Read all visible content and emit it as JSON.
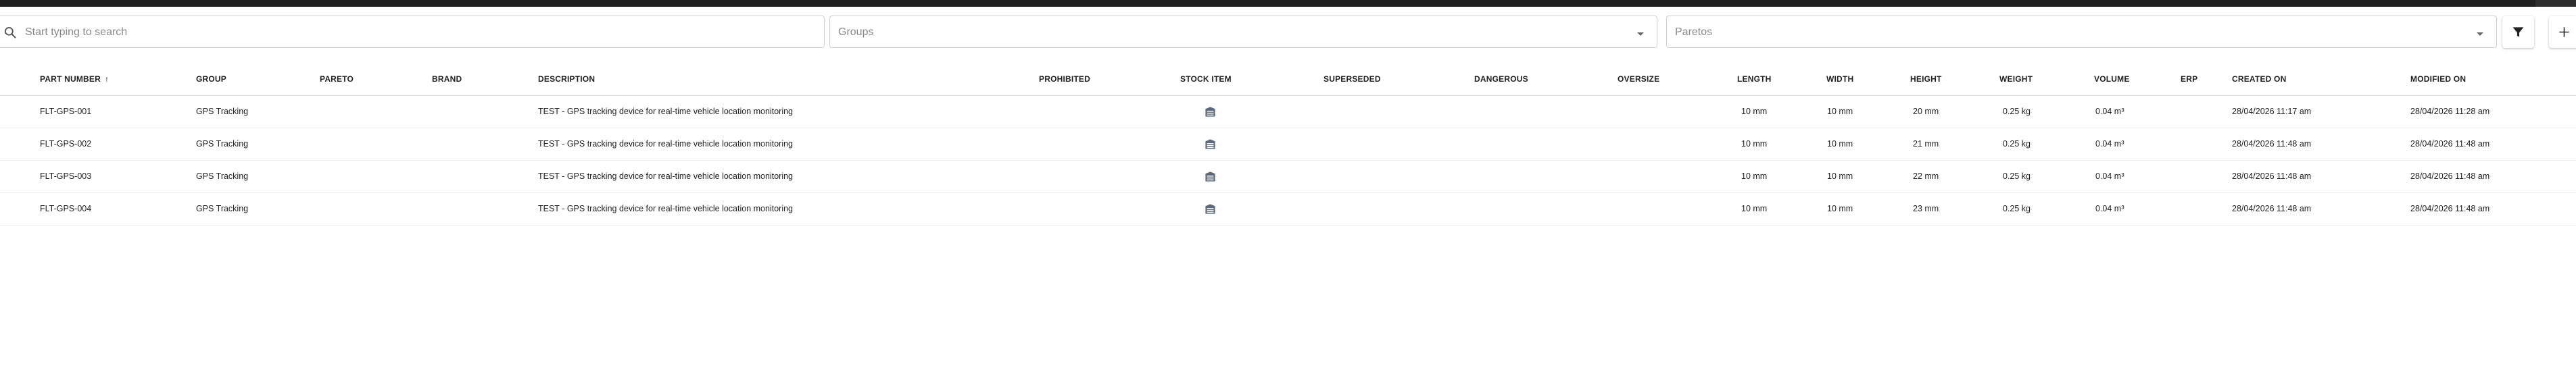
{
  "search": {
    "placeholder": "Start typing to search"
  },
  "filters": {
    "groups_placeholder": "Groups",
    "paretos_placeholder": "Paretos"
  },
  "toolbar": {
    "filter_icon": "filter-icon",
    "add_icon": "plus-icon"
  },
  "table": {
    "headers": {
      "part_number": "PART NUMBER",
      "group": "GROUP",
      "pareto": "PARETO",
      "brand": "BRAND",
      "description": "DESCRIPTION",
      "prohibited": "PROHIBITED",
      "stock_item": "STOCK ITEM",
      "superseded": "SUPERSEDED",
      "dangerous": "DANGEROUS",
      "oversize": "OVERSIZE",
      "length": "LENGTH",
      "width": "WIDTH",
      "height": "HEIGHT",
      "weight": "WEIGHT",
      "volume": "VOLUME",
      "erp": "ERP",
      "created_on": "CREATED ON",
      "modified_on": "MODIFIED ON"
    },
    "sort": {
      "column": "part_number",
      "direction": "asc",
      "indicator": "↑"
    },
    "rows": [
      {
        "part_number": "FLT-GPS-001",
        "group": "GPS Tracking",
        "pareto": "",
        "brand": "",
        "description": "TEST - GPS tracking device for real-time vehicle location monitoring",
        "stock_icon": "warehouse-icon",
        "length": "10 mm",
        "width": "10 mm",
        "height": "20 mm",
        "weight": "0.25 kg",
        "volume": "0.04 m³",
        "erp": "",
        "created_on": "28/04/2026 11:17 am",
        "modified_on": "28/04/2026 11:28 am"
      },
      {
        "part_number": "FLT-GPS-002",
        "group": "GPS Tracking",
        "pareto": "",
        "brand": "",
        "description": "TEST - GPS tracking device for real-time vehicle location monitoring",
        "stock_icon": "warehouse-icon",
        "length": "10 mm",
        "width": "10 mm",
        "height": "21 mm",
        "weight": "0.25 kg",
        "volume": "0.04 m³",
        "erp": "",
        "created_on": "28/04/2026 11:48 am",
        "modified_on": "28/04/2026 11:48 am"
      },
      {
        "part_number": "FLT-GPS-003",
        "group": "GPS Tracking",
        "pareto": "",
        "brand": "",
        "description": "TEST - GPS tracking device for real-time vehicle location monitoring",
        "stock_icon": "warehouse-icon",
        "length": "10 mm",
        "width": "10 mm",
        "height": "22 mm",
        "weight": "0.25 kg",
        "volume": "0.04 m³",
        "erp": "",
        "created_on": "28/04/2026 11:48 am",
        "modified_on": "28/04/2026 11:48 am"
      },
      {
        "part_number": "FLT-GPS-004",
        "group": "GPS Tracking",
        "pareto": "",
        "brand": "",
        "description": "TEST - GPS tracking device for real-time vehicle location monitoring",
        "stock_icon": "warehouse-icon",
        "length": "10 mm",
        "width": "10 mm",
        "height": "23 mm",
        "weight": "0.25 kg",
        "volume": "0.04 m³",
        "erp": "",
        "created_on": "28/04/2026 11:48 am",
        "modified_on": "28/04/2026 11:48 am"
      }
    ]
  },
  "colors": {
    "stock_icon": "#5b6b7a",
    "topbar": "#1f1f1f",
    "border": "#cfcfcf"
  }
}
